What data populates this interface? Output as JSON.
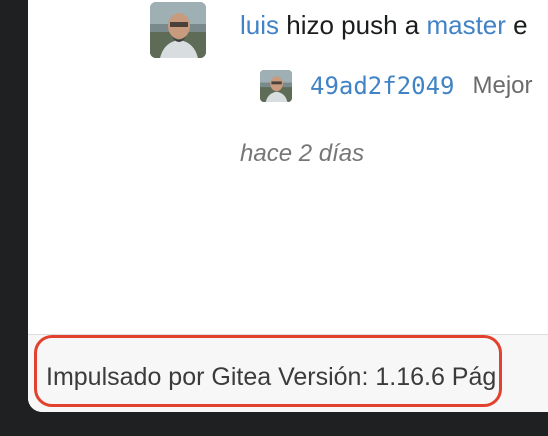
{
  "feed": {
    "user": "luis",
    "action_text": " hizo push a ",
    "branch": "master",
    "trailing": " e",
    "commit": {
      "sha": "49ad2f2049",
      "message": "Mejor"
    },
    "time": "hace 2 días"
  },
  "footer": {
    "powered_by": "Impulsado por Gitea Versión: 1.16.6",
    "trailing": " Pág"
  },
  "colors": {
    "link": "#4183c4",
    "highlight": "#e2422d"
  }
}
